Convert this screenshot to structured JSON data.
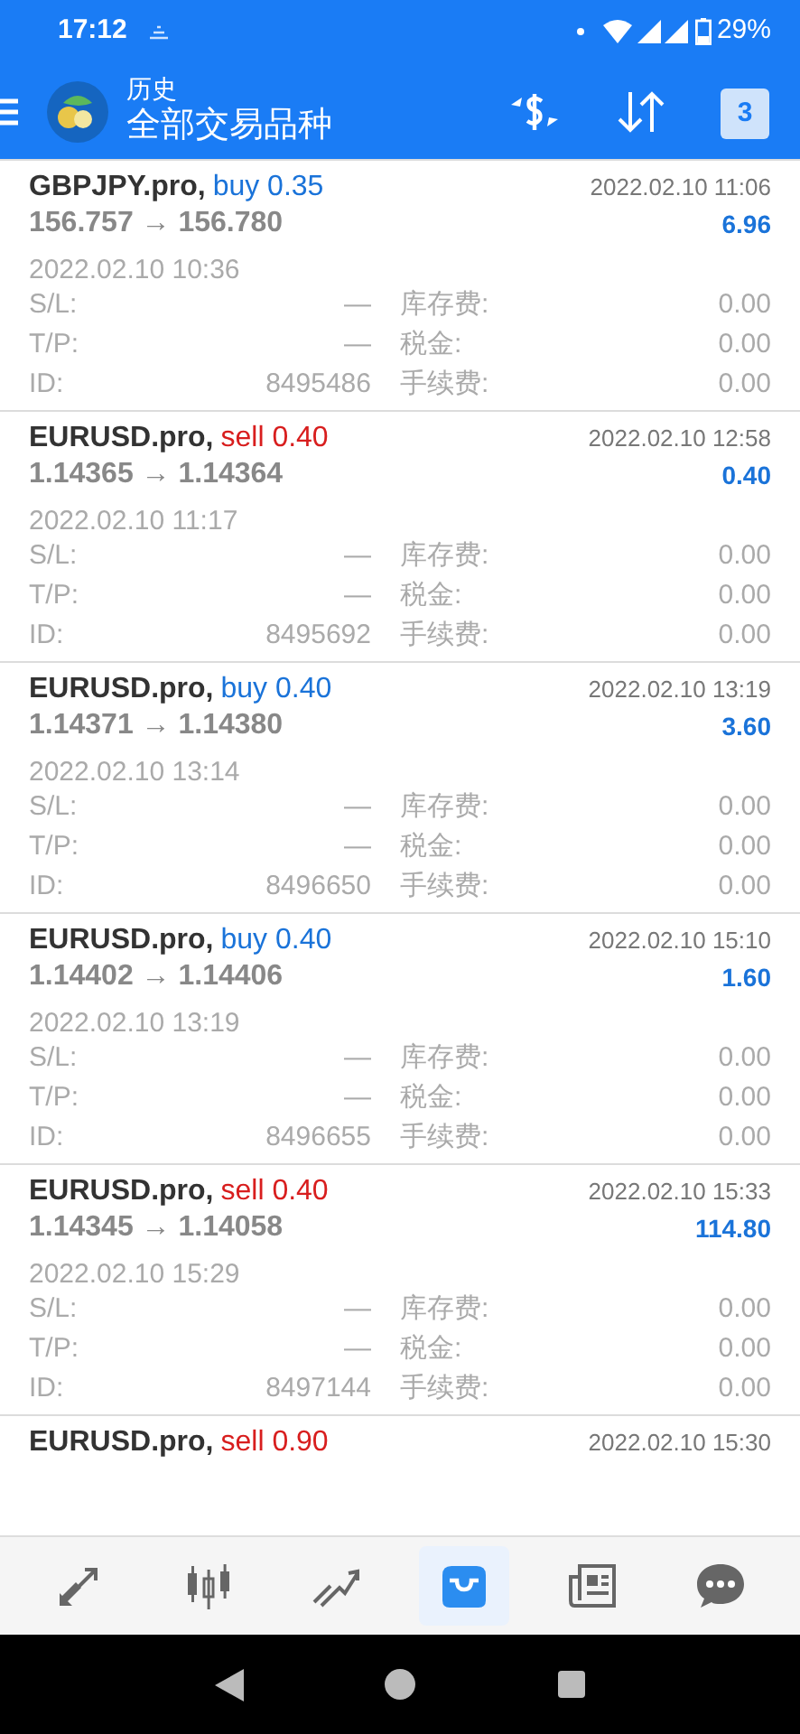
{
  "status_bar": {
    "time": "17:12",
    "battery": "29%"
  },
  "header": {
    "subtitle": "历史",
    "title": "全部交易品种",
    "calendar_day": "3"
  },
  "trades": [
    {
      "symbol": "GBPJPY.pro,",
      "kind": "buy",
      "order": "buy 0.35",
      "prices": "156.757 → 156.780",
      "close_time": "2022.02.10 11:06",
      "profit": "6.96",
      "open_time": "2022.02.10 10:36",
      "fields": [
        {
          "label": "S/L:",
          "value": "—"
        },
        {
          "label": "库存费:",
          "value": "0.00"
        },
        {
          "label": "T/P:",
          "value": "—"
        },
        {
          "label": "税金:",
          "value": "0.00"
        },
        {
          "label": "ID:",
          "value": "8495486"
        },
        {
          "label": "手续费:",
          "value": "0.00"
        }
      ]
    },
    {
      "symbol": "EURUSD.pro,",
      "kind": "sell",
      "order": "sell 0.40",
      "prices": "1.14365 → 1.14364",
      "close_time": "2022.02.10 12:58",
      "profit": "0.40",
      "open_time": "2022.02.10 11:17",
      "fields": [
        {
          "label": "S/L:",
          "value": "—"
        },
        {
          "label": "库存费:",
          "value": "0.00"
        },
        {
          "label": "T/P:",
          "value": "—"
        },
        {
          "label": "税金:",
          "value": "0.00"
        },
        {
          "label": "ID:",
          "value": "8495692"
        },
        {
          "label": "手续费:",
          "value": "0.00"
        }
      ]
    },
    {
      "symbol": "EURUSD.pro,",
      "kind": "buy",
      "order": "buy 0.40",
      "prices": "1.14371 → 1.14380",
      "close_time": "2022.02.10 13:19",
      "profit": "3.60",
      "open_time": "2022.02.10 13:14",
      "fields": [
        {
          "label": "S/L:",
          "value": "—"
        },
        {
          "label": "库存费:",
          "value": "0.00"
        },
        {
          "label": "T/P:",
          "value": "—"
        },
        {
          "label": "税金:",
          "value": "0.00"
        },
        {
          "label": "ID:",
          "value": "8496650"
        },
        {
          "label": "手续费:",
          "value": "0.00"
        }
      ]
    },
    {
      "symbol": "EURUSD.pro,",
      "kind": "buy",
      "order": "buy 0.40",
      "prices": "1.14402 → 1.14406",
      "close_time": "2022.02.10 15:10",
      "profit": "1.60",
      "open_time": "2022.02.10 13:19",
      "fields": [
        {
          "label": "S/L:",
          "value": "—"
        },
        {
          "label": "库存费:",
          "value": "0.00"
        },
        {
          "label": "T/P:",
          "value": "—"
        },
        {
          "label": "税金:",
          "value": "0.00"
        },
        {
          "label": "ID:",
          "value": "8496655"
        },
        {
          "label": "手续费:",
          "value": "0.00"
        }
      ]
    },
    {
      "symbol": "EURUSD.pro,",
      "kind": "sell",
      "order": "sell 0.40",
      "prices": "1.14345 → 1.14058",
      "close_time": "2022.02.10 15:33",
      "profit": "114.80",
      "open_time": "2022.02.10 15:29",
      "fields": [
        {
          "label": "S/L:",
          "value": "—"
        },
        {
          "label": "库存费:",
          "value": "0.00"
        },
        {
          "label": "T/P:",
          "value": "—"
        },
        {
          "label": "税金:",
          "value": "0.00"
        },
        {
          "label": "ID:",
          "value": "8497144"
        },
        {
          "label": "手续费:",
          "value": "0.00"
        }
      ]
    },
    {
      "symbol": "EURUSD.pro,",
      "kind": "sell",
      "order": "sell 0.90",
      "close_time": "2022.02.10 15:30"
    }
  ],
  "nav": [
    {
      "kind": "trade",
      "selected": false
    },
    {
      "kind": "quotes",
      "selected": false
    },
    {
      "kind": "chart",
      "selected": false
    },
    {
      "kind": "history",
      "selected": true
    },
    {
      "kind": "news",
      "selected": false
    },
    {
      "kind": "chat",
      "selected": false
    }
  ]
}
